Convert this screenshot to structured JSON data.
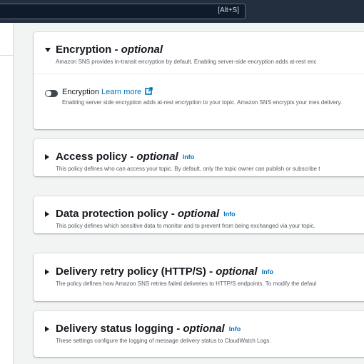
{
  "search": {
    "shortcut": "[Alt+S]"
  },
  "encryption": {
    "title": "Encryption - ",
    "optional": "optional",
    "description": "Amazon SNS provides in-transit encryption by default. Enabling server-side encryption adds at-rest enc",
    "toggle_label": "Encryption ",
    "learn_more": "Learn more",
    "toggle_description": "Enabling server side encryption adds at-rest encryption to your topic. Amazon SNS encrypts your mes delivery."
  },
  "access_policy": {
    "title": "Access policy - ",
    "optional": "optional",
    "info": "Info",
    "description": "This policy defines who can access your topic. By default, only the topic owner can publish or subscribe t"
  },
  "data_protection": {
    "title": "Data protection policy - ",
    "optional": "optional",
    "info": "Info",
    "description": "This policy defines which sensitive data to monitor and to prevent from being exchanged via your topic."
  },
  "delivery_retry": {
    "title": "Delivery retry policy (HTTP/S) - ",
    "optional": "optional",
    "info": "Info",
    "description": "The policy defines how Amazon SNS retries failed deliveries to HTTP/S endpoints. To modify the defaul"
  },
  "delivery_logging": {
    "title": "Delivery status logging - ",
    "optional": "optional",
    "info": "Info",
    "description": "These settings configure the logging of message delivery status to CloudWatch Logs."
  },
  "colors": {
    "link": "#0073bb",
    "header_bg": "#232f3e",
    "page_bg": "#f2f3f3"
  },
  "icons": {
    "expanded": "caret-down-icon",
    "collapsed": "caret-right-icon",
    "external": "external-link-icon",
    "toggle": "toggle-off"
  }
}
